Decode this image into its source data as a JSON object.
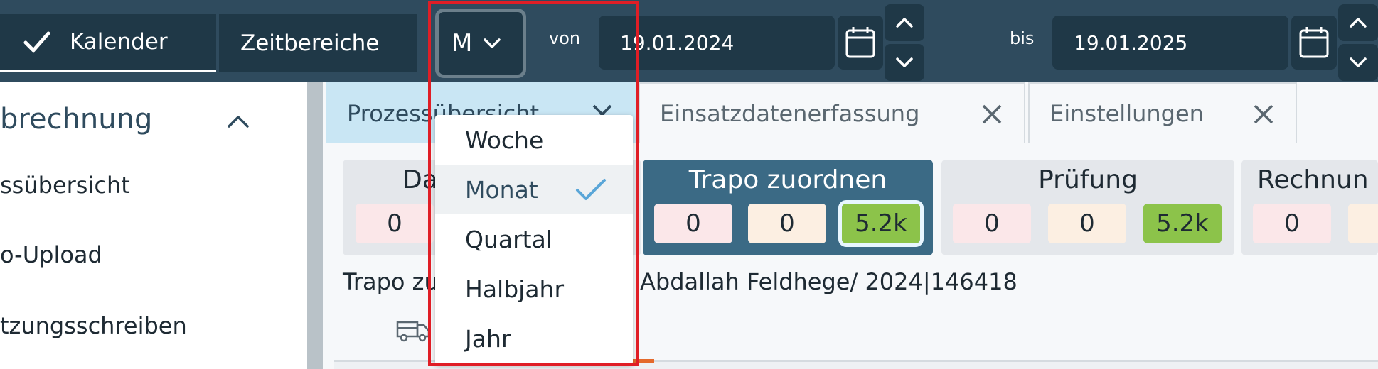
{
  "topbar": {
    "calendar_label": "Kalender",
    "timeranges_label": "Zeitbereiche",
    "period_select_value": "M",
    "from_label": "von",
    "from_date": "19.01.2024",
    "to_label": "bis",
    "to_date": "19.01.2025"
  },
  "sidebar": {
    "section_title": "brechnung",
    "items": [
      {
        "label": "ssübersicht"
      },
      {
        "label": "o-Upload"
      },
      {
        "label": "tzungsschreiben"
      }
    ]
  },
  "tabs": [
    {
      "label": "Prozessübersicht",
      "active": true
    },
    {
      "label": "Einsatzdatenerfassung",
      "active": false
    },
    {
      "label": "Einstellungen",
      "active": false
    }
  ],
  "cards": [
    {
      "title": "Da",
      "values": [
        "0"
      ]
    },
    {
      "title": "Trapo zuordnen",
      "values": [
        "0",
        "0",
        "5.2k"
      ]
    },
    {
      "title": "Prüfung",
      "values": [
        "0",
        "0",
        "5.2k"
      ]
    },
    {
      "title": "Rechnun",
      "values": [
        "0"
      ]
    }
  ],
  "info": {
    "left": "Trapo zu",
    "right": "Abdallah Feldhege/ 2024|146418"
  },
  "dropdown": {
    "options": [
      "Woche",
      "Monat",
      "Quartal",
      "Halbjahr",
      "Jahr"
    ],
    "selected": "Monat"
  },
  "colors": {
    "topbar": "#2f4b5e",
    "button_bg": "#1f3847",
    "active_card": "#3b6a85",
    "green": "#8cc34a",
    "highlight": "#e01e26",
    "check": "#5aa6d8"
  },
  "icons": [
    "check-icon",
    "chevron-down-icon",
    "calendar-icon",
    "chevron-up-icon",
    "close-icon",
    "truck-icon"
  ]
}
